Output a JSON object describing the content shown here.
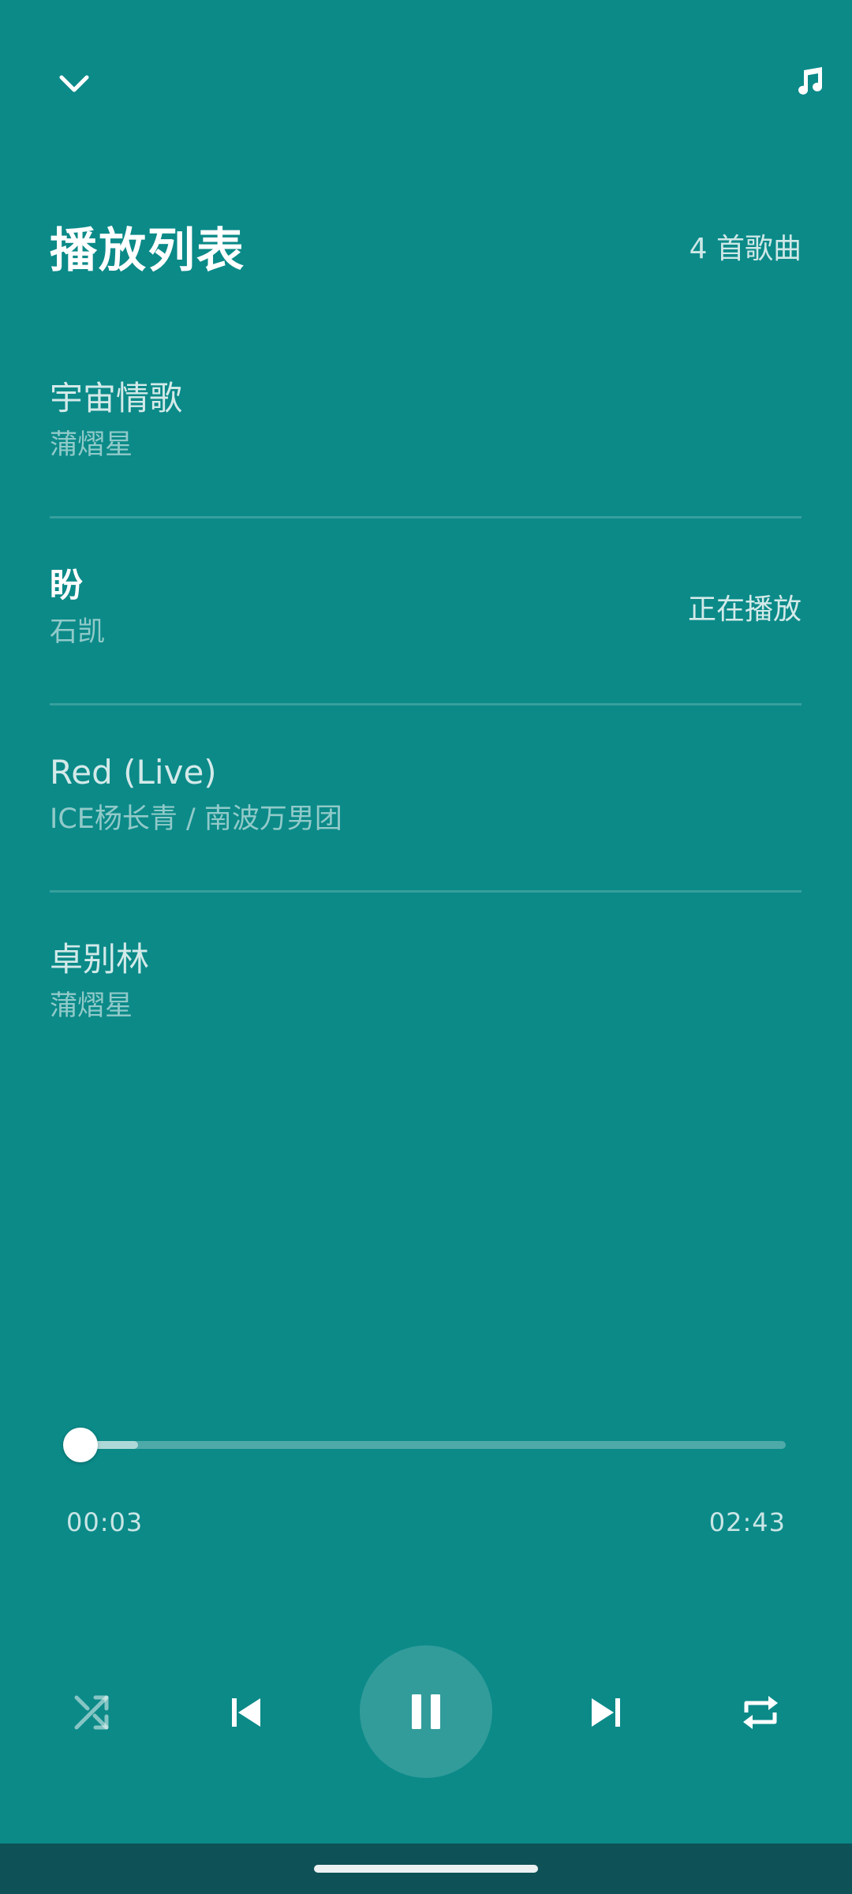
{
  "header": {
    "title": "播放列表",
    "count": "4 首歌曲",
    "collapse_icon": "chevron-down-icon",
    "note_icon": "music-note-icon"
  },
  "playlist": [
    {
      "title": "宇宙情歌",
      "artist": "蒲熠星",
      "status": ""
    },
    {
      "title": "盼",
      "artist": "石凯",
      "status": "正在播放"
    },
    {
      "title": "Red (Live)",
      "artist": "ICE杨长青 / 南波万男团",
      "status": ""
    },
    {
      "title": "卓别林",
      "artist": "蒲熠星",
      "status": ""
    }
  ],
  "player": {
    "elapsed": "00:03",
    "total": "02:43",
    "progress_fraction": 0.02
  },
  "controls": {
    "shuffle_icon": "shuffle-icon",
    "prev_icon": "skip-previous-icon",
    "pause_icon": "pause-icon",
    "next_icon": "skip-next-icon",
    "repeat_icon": "repeat-icon"
  },
  "colors": {
    "background": "#0b8a88",
    "nav_bar": "#0e5257",
    "foreground": "#ffffff"
  }
}
